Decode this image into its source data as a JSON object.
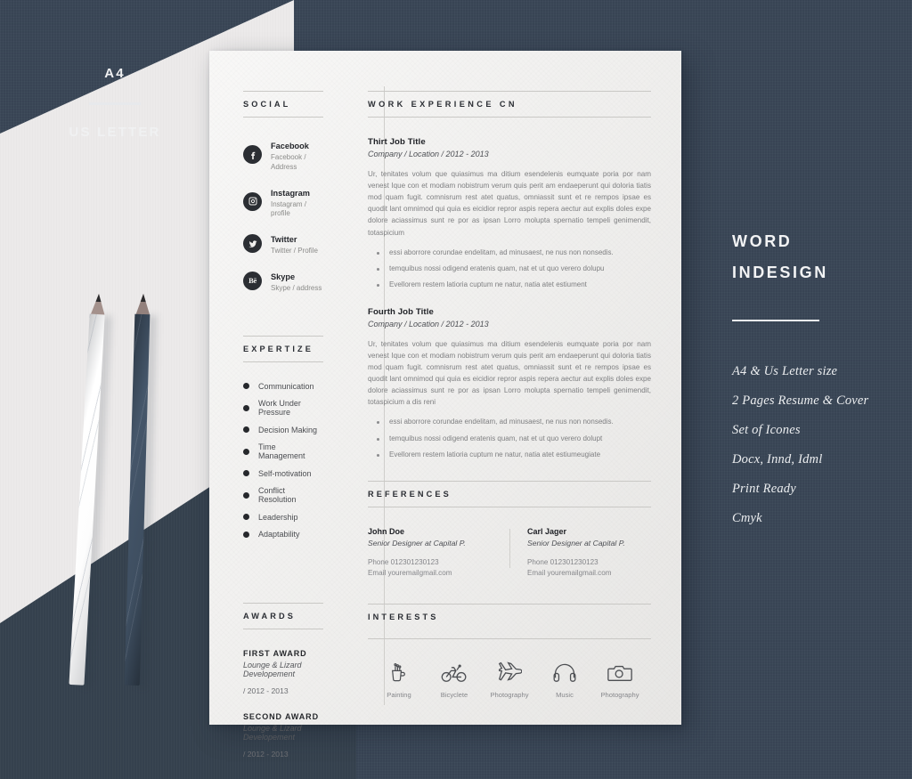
{
  "left_panel": {
    "size_primary": "A4",
    "size_secondary": "US LETTER"
  },
  "right_panel": {
    "title_line1": "WORD",
    "title_line2": "INDESIGN",
    "features": [
      "A4 & Us Letter size",
      "2 Pages Resume & Cover",
      "Set of Iconеs",
      "Docx, Innd, Idml",
      "Print Ready",
      "Cmyk"
    ]
  },
  "resume": {
    "social": {
      "heading": "SOCIAL",
      "items": [
        {
          "icon": "facebook-icon",
          "name": "Facebook",
          "handle": "Facebook / Address"
        },
        {
          "icon": "instagram-icon",
          "name": "Instagram",
          "handle": "Instagram / profile"
        },
        {
          "icon": "twitter-icon",
          "name": "Twitter",
          "handle": "Twitter / Profile"
        },
        {
          "icon": "behance-icon",
          "name": "Skype",
          "handle": "Skype / address"
        }
      ]
    },
    "expertize": {
      "heading": "EXPERTIZE",
      "skills": [
        "Communication",
        "Work Under Pressure",
        "Decision Making",
        "Time Management",
        "Self-motivation",
        "Conflict Resolution",
        "Leadership",
        "Adaptability"
      ]
    },
    "awards": {
      "heading": "AWARDS",
      "items": [
        {
          "title": "FIRST AWARD",
          "subtitle": "Lounge & Lizard Developement",
          "date": "/ 2012 - 2013"
        },
        {
          "title": "SECOND AWARD",
          "subtitle": "Lounge & Lizard Developement",
          "date": "/ 2012 - 2013"
        }
      ]
    },
    "work": {
      "heading": "WORK EXPERIENCE CN",
      "jobs": [
        {
          "title": "Thirt Job Title",
          "meta": "Company / Location / 2012 - 2013",
          "body": "Ur, tenitates volum que quiasimus ma ditium esendelenis eumquate poria por nam venest Ique con et modiam nobistrum verum quis perit am endaeperunt qui doloria tiatis mod quam fugit. comnisrum rest atet quatus, omniassit sunt et re rempos ipsae es quodit lant omnimod qui quia es eicidior repror aspis repera aectur aut explis doles expe dolore aciassimus sunt re por as ipsan Lorro molupta spernatio tempeli genimendit, totaspicium",
          "bullets": [
            "essi aborrore corundae endelitam, ad minusaest, ne nus non nonsedis.",
            "temquibus nossi odigend eratenis quam, nat et ut quo verero dolupu",
            "Evellorem restem latioria cuptum ne natur, natia atet estiument"
          ]
        },
        {
          "title": "Fourth Job Title",
          "meta": "Company / Location / 2012 - 2013",
          "body": "Ur, tenitates volum que quiasimus ma ditium esendelenis eumquate poria por nam venest Ique con et modiam nobistrum verum quis perit am endaeperunt qui doloria tiatis mod quam fugit. comnisrum rest atet quatus, omniassit sunt et re rempos ipsae es quodit lant omnimod qui quia es eicidior repror aspis repera aectur aut explis doles expe dolore aciassimus sunt re por as ipsan Lorro molupta spernatio tempeli genimendit, totaspicium a dis reni",
          "bullets": [
            "essi aborrore corundae endelitam, ad minusaest, ne nus non nonsedis.",
            "temquibus nossi odigend eratenis quam, nat et ut quo verero dolupt",
            "Evellorem restem latioria cuptum ne natur, natia atet estiumeugiate"
          ]
        }
      ]
    },
    "references": {
      "heading": "REFERENCES",
      "items": [
        {
          "name": "John Doe",
          "role": "Senior Designer at Capital P.",
          "phone": "Phone 012301230123",
          "email": "Email youremailgmail.com"
        },
        {
          "name": "Carl Jager",
          "role": "Senior Designer at Capital P.",
          "phone": "Phone 012301230123",
          "email": "Email youremailgmail.com"
        }
      ]
    },
    "interests": {
      "heading": "INTERESTS",
      "items": [
        {
          "icon": "painting-icon",
          "label": "Painting"
        },
        {
          "icon": "bicycle-icon",
          "label": "Bicyclete"
        },
        {
          "icon": "airplane-icon",
          "label": "Photography"
        },
        {
          "icon": "headphones-icon",
          "label": "Music"
        },
        {
          "icon": "camera-icon",
          "label": "Photography"
        }
      ]
    }
  },
  "colors": {
    "navy": "#3a4757",
    "navy_dark": "#36424f",
    "paper": "#f0efed",
    "light_gray": "#eceaea",
    "ink": "#26282c"
  }
}
